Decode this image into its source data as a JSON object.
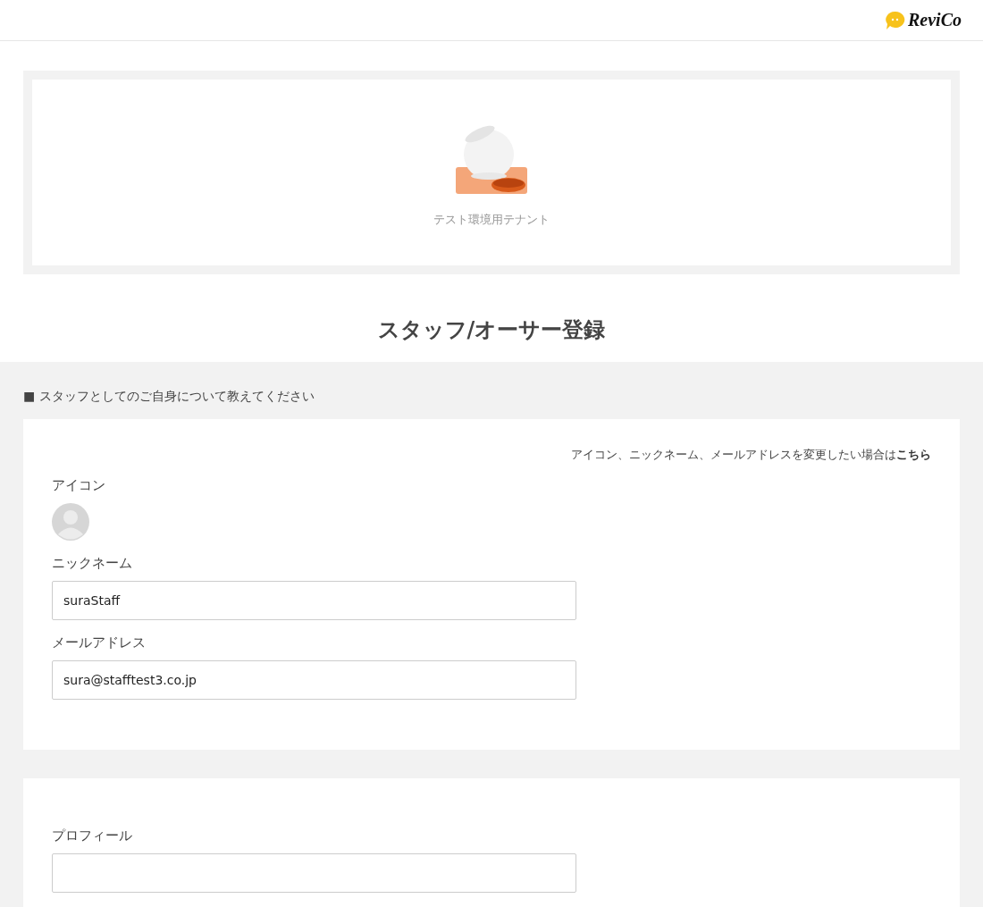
{
  "header": {
    "logo": "ReviCo"
  },
  "tenant": {
    "name": "テスト環境用テナント"
  },
  "page_title": "スタッフ/オーサー登録",
  "section": {
    "heading": "■ スタッフとしてのご自身について教えてください"
  },
  "profile_card": {
    "note": {
      "text": "アイコン、ニックネーム、メールアドレスを変更したい場合は",
      "link": "こちら"
    },
    "fields": [
      {
        "kind": "avatar",
        "label": "アイコン"
      },
      {
        "kind": "text",
        "label": "ニックネーム",
        "value": "suraStaff"
      },
      {
        "kind": "text",
        "label": "メールアドレス",
        "value": "sura@stafftest3.co.jp"
      }
    ]
  },
  "second_card": {
    "fields": [
      {
        "kind": "text",
        "label": "プロフィール"
      }
    ]
  }
}
